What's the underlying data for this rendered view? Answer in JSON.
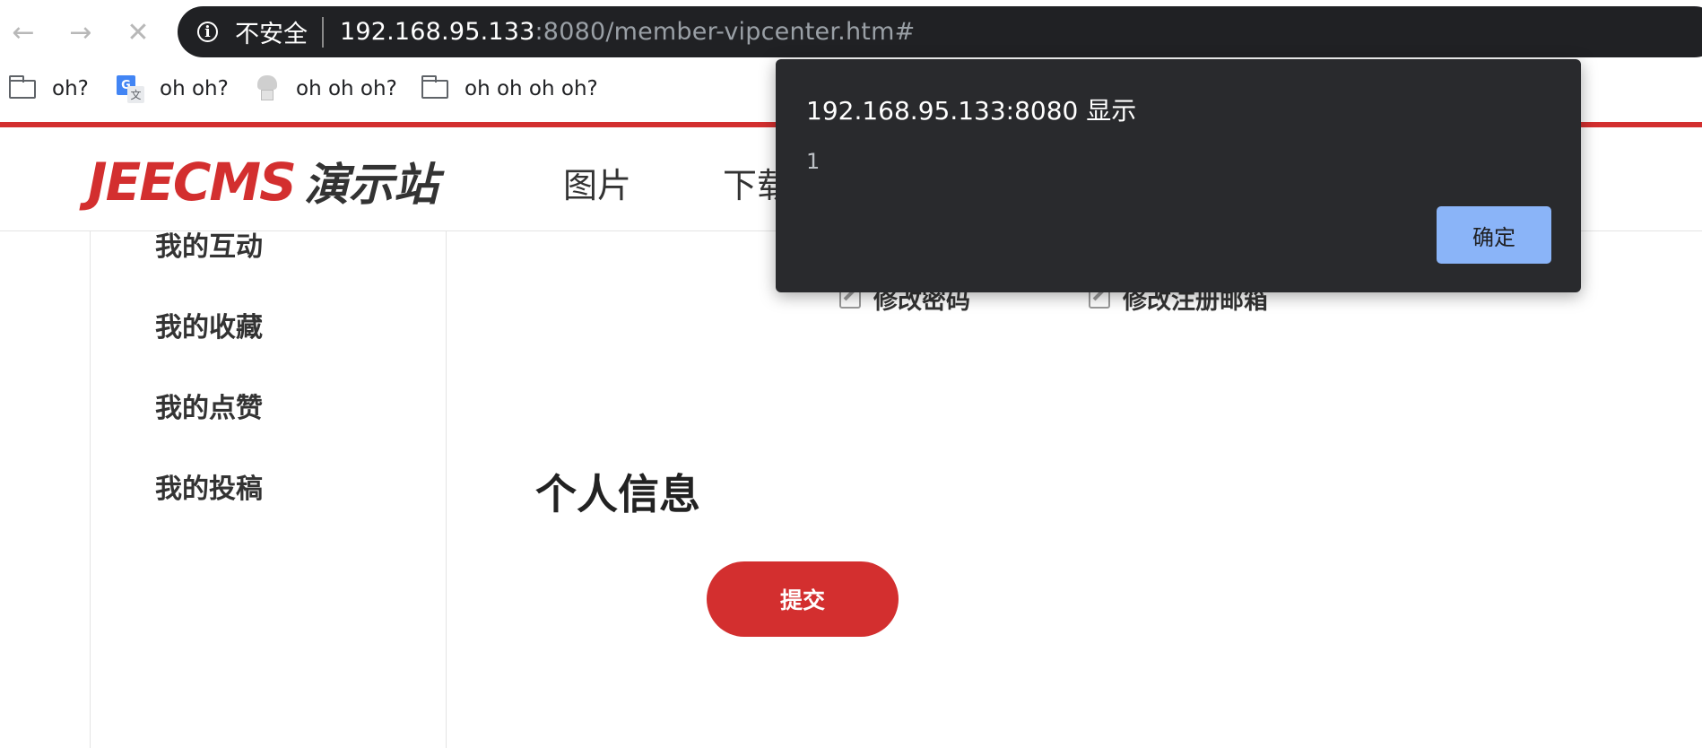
{
  "browser": {
    "security_label": "不安全",
    "url_host": "192.168.95.133",
    "url_rest": ":8080/member-vipcenter.htm#",
    "bookmarks": [
      {
        "label": "oh?",
        "icon": "folder-icon"
      },
      {
        "label": "oh oh?",
        "icon": "translate-icon"
      },
      {
        "label": "oh oh oh?",
        "icon": "chef-hat-icon"
      },
      {
        "label": "oh oh oh oh?",
        "icon": "folder-icon"
      }
    ]
  },
  "site": {
    "logo_latin": "JEECMS",
    "logo_cjk": "演示站",
    "menu": [
      "图片",
      "下载"
    ],
    "brand_color": "#d32f2f"
  },
  "sidebar": {
    "items": [
      "我的互动",
      "我的收藏",
      "我的点赞",
      "我的投稿"
    ]
  },
  "main": {
    "actions": [
      "修改密码",
      "修改注册邮箱"
    ],
    "section_title": "个人信息",
    "submit_label": "提交"
  },
  "dialog": {
    "title": "192.168.95.133:8080 显示",
    "message": "1",
    "ok_label": "确定"
  }
}
